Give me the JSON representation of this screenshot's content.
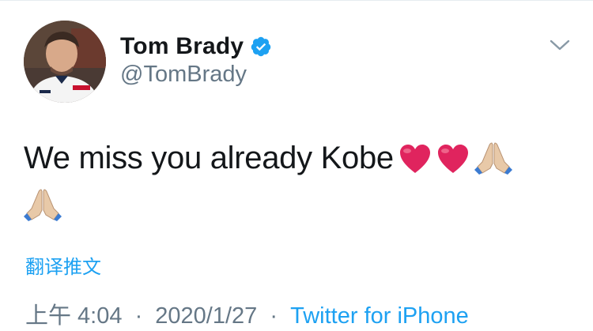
{
  "user": {
    "display_name": "Tom Brady",
    "handle": "@TomBrady",
    "verified": true,
    "avatar_icon": "profile-photo"
  },
  "tweet": {
    "text": "We miss you already Kobe",
    "emojis": [
      "red-heart",
      "red-heart",
      "folded-hands",
      "folded-hands"
    ]
  },
  "actions": {
    "translate_label": "翻译推文",
    "menu_icon": "chevron-down-icon"
  },
  "meta": {
    "time": "上午 4:04",
    "date": "2020/1/27",
    "separator": "·",
    "source": "Twitter for iPhone"
  },
  "colors": {
    "link": "#1da1f2",
    "secondary_text": "#657786",
    "primary_text": "#14171a",
    "heart": "#e0245e"
  }
}
